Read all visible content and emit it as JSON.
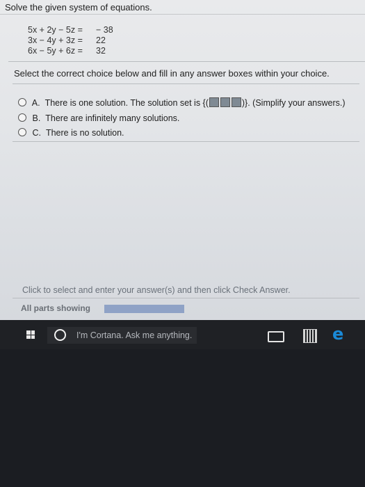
{
  "question": {
    "title": "Solve the given system of equations.",
    "equations": [
      {
        "left": "5x + 2y − 5z =",
        "right": "− 38"
      },
      {
        "left": "3x − 4y + 3z =",
        "right": "22"
      },
      {
        "left": "6x − 5y + 6z =",
        "right": "32"
      }
    ],
    "instruction": "Select the correct choice below and fill in any answer boxes within your choice.",
    "choices": [
      {
        "letter": "A.",
        "text_before": "There is one solution. The solution set is {(",
        "text_after": ")}. (Simplify your answers.)"
      },
      {
        "letter": "B.",
        "text": "There are infinitely many solutions."
      },
      {
        "letter": "C.",
        "text": "There is no solution."
      }
    ]
  },
  "footer": {
    "hint": "Click to select and enter your answer(s) and then click Check Answer.",
    "parts_label": "All parts showing",
    "progress": 1.0
  },
  "taskbar": {
    "search_placeholder": "I'm Cortana. Ask me anything."
  },
  "colors": {
    "progress_fill": "#8fa2c6",
    "edge_blue": "#1a8ad8"
  }
}
